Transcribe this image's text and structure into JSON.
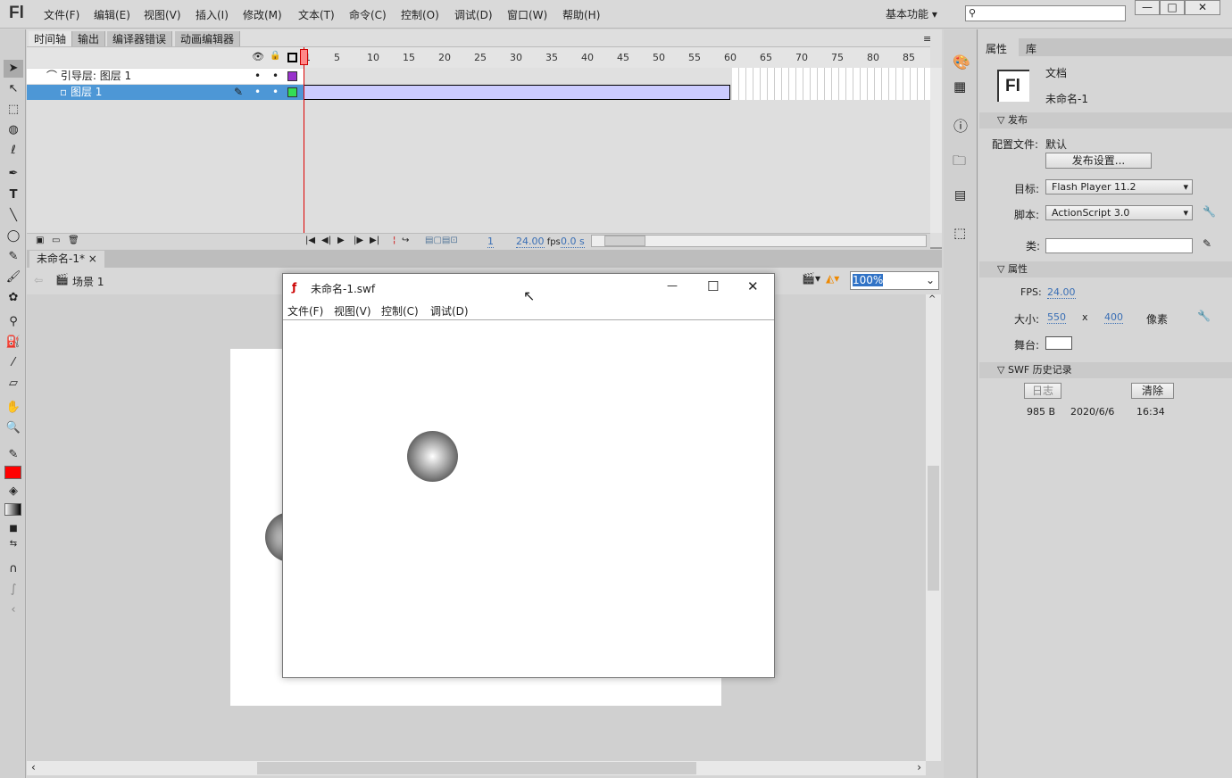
{
  "app": {
    "logo": "Fl",
    "menus": [
      "文件(F)",
      "编辑(E)",
      "视图(V)",
      "插入(I)",
      "修改(M)",
      "文本(T)",
      "命令(C)",
      "控制(O)",
      "调试(D)",
      "窗口(W)",
      "帮助(H)"
    ],
    "workspace": "基本功能",
    "search_placeholder": ""
  },
  "timeline": {
    "tabs": [
      "时间轴",
      "输出",
      "编译器错误",
      "动画编辑器"
    ],
    "frame_labels": [
      "1",
      "5",
      "10",
      "15",
      "20",
      "25",
      "30",
      "35",
      "40",
      "45",
      "50",
      "55",
      "60",
      "65",
      "70",
      "75",
      "80",
      "85"
    ],
    "layers": [
      {
        "name": "引导层: 图层 1",
        "type": "guide",
        "color": "#9933cc"
      },
      {
        "name": "图层 1",
        "type": "guided",
        "color": "#33dd55",
        "selected": true
      }
    ],
    "span_end_frame": 60,
    "current_frame": "1",
    "fps": "24.00",
    "fps_unit": "fps",
    "time": "0.0 s"
  },
  "document": {
    "tab": "未命名-1*",
    "scene": "场景 1",
    "zoom": "100%"
  },
  "swf_window": {
    "title": "未命名-1.swf",
    "menus": [
      "文件(F)",
      "视图(V)",
      "控制(C)",
      "调试(D)"
    ]
  },
  "properties": {
    "tabs": [
      "属性",
      "库"
    ],
    "doc_icon": "Fl",
    "doc_type": "文档",
    "doc_name": "未命名-1",
    "publish": {
      "header": "发布",
      "profile_label": "配置文件:",
      "profile_value": "默认",
      "settings_button": "发布设置...",
      "target_label": "目标:",
      "target_value": "Flash Player 11.2",
      "script_label": "脚本:",
      "script_value": "ActionScript 3.0",
      "class_label": "类:"
    },
    "props": {
      "header": "属性",
      "fps_label": "FPS:",
      "fps_value": "24.00",
      "size_label": "大小:",
      "width": "550",
      "x": "x",
      "height": "400",
      "unit": "像素",
      "stage_label": "舞台:",
      "stage_color": "#ffffff"
    },
    "swf_history": {
      "header": "SWF 历史记录",
      "log_button": "日志",
      "clear_button": "清除",
      "size": "985 B",
      "date": "2020/6/6",
      "time": "16:34"
    }
  }
}
